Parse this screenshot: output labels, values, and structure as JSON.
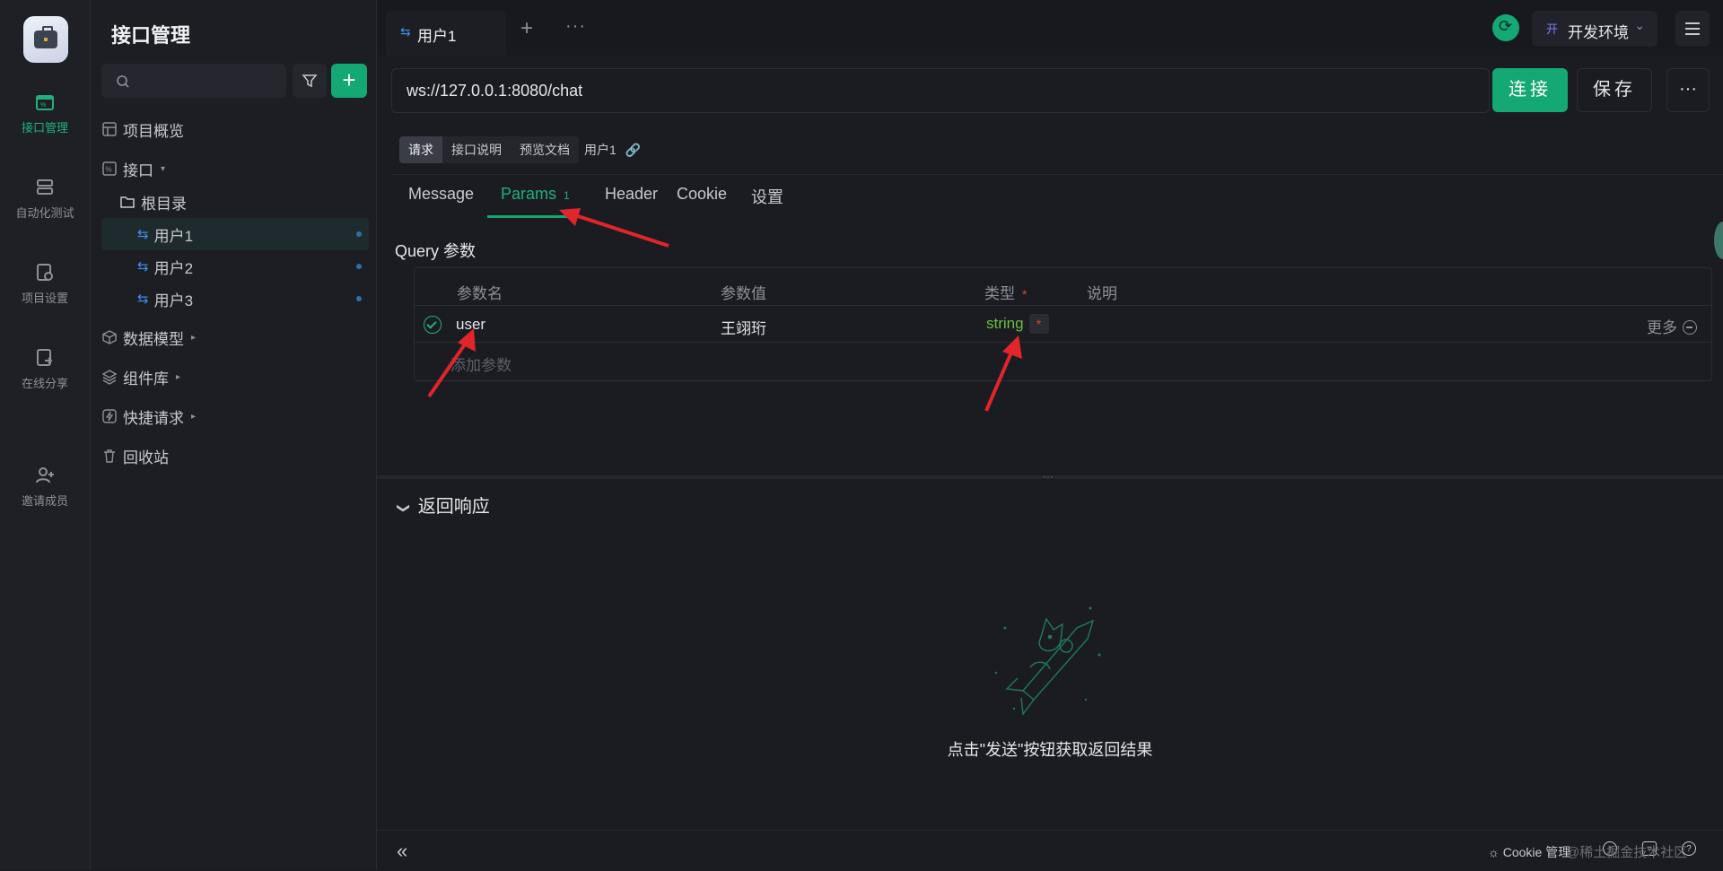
{
  "rail": {
    "items": [
      {
        "label": "接口管理"
      },
      {
        "label": "自动化测试"
      },
      {
        "label": "项目设置"
      },
      {
        "label": "在线分享"
      },
      {
        "label": "邀请成员"
      }
    ]
  },
  "sidebar": {
    "title": "接口管理",
    "search_placeholder": "",
    "add_label": "+",
    "tree": [
      {
        "label": "项目概览"
      },
      {
        "label": "接口"
      },
      {
        "label": "根目录"
      },
      {
        "label": "用户1"
      },
      {
        "label": "用户2"
      },
      {
        "label": "用户3"
      },
      {
        "label": "数据模型"
      },
      {
        "label": "组件库"
      },
      {
        "label": "快捷请求"
      },
      {
        "label": "回收站"
      }
    ]
  },
  "topbar": {
    "tab_label": "用户1",
    "env_icon": "开",
    "env_label": "开发环境"
  },
  "request": {
    "url": "ws://127.0.0.1:8080/chat",
    "connect_label": "连接",
    "save_label": "保存",
    "more_label": "···"
  },
  "subtabs": {
    "items": [
      "请求",
      "接口说明",
      "预览文档"
    ],
    "name": "用户1"
  },
  "param_tabs": {
    "items": [
      "Message",
      "Params",
      "Header",
      "Cookie",
      "设置"
    ],
    "params_badge": "1",
    "active": "Params"
  },
  "query": {
    "title": "Query 参数",
    "headers": [
      "参数名",
      "参数值",
      "类型",
      "说明"
    ],
    "rows": [
      {
        "name": "user",
        "value": "王翊珩",
        "type": "string",
        "required": "*"
      }
    ],
    "more_label": "更多",
    "add_placeholder": "添加参数"
  },
  "response": {
    "title": "返回响应",
    "empty_text": "点击\"发送\"按钮获取返回结果"
  },
  "bottombar": {
    "cookie_label": "Cookie 管理",
    "watermark": "@稀土掘金技术社区"
  },
  "colors": {
    "accent": "#14a874",
    "annotation_arrow": "#e0252b",
    "type_string": "#6fbf3e",
    "required": "#e0443c"
  }
}
